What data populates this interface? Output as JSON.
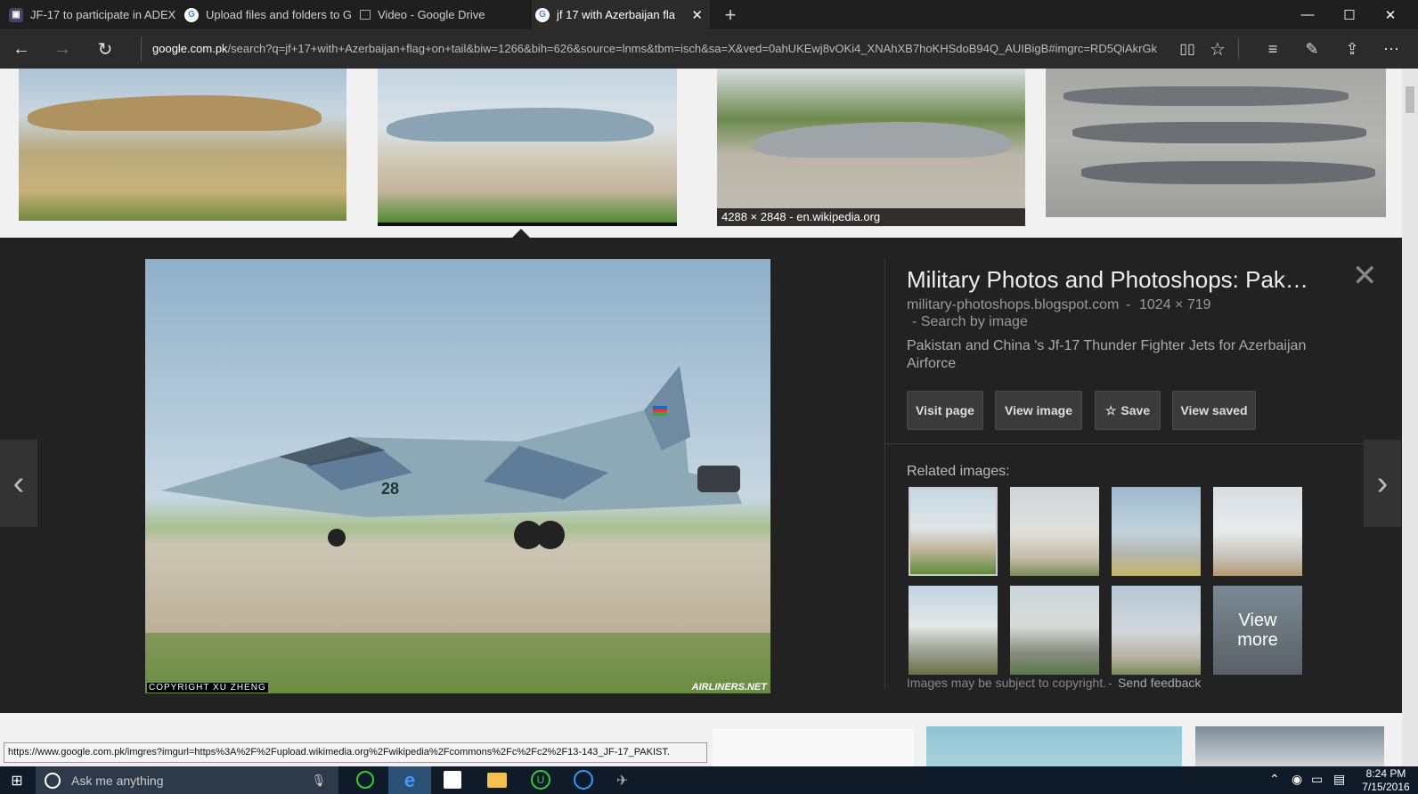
{
  "tabs": [
    {
      "label": "JF-17 to participate in ADEX",
      "icon": "site-favicon"
    },
    {
      "label": "Upload files and folders to G",
      "icon": "google-icon"
    },
    {
      "label": "Video - Google Drive",
      "icon": "page-icon"
    },
    {
      "label": "jf 17 with Azerbaijan fla",
      "icon": "google-icon"
    }
  ],
  "window": {
    "minimize": "—",
    "maximize": "☐",
    "close": "✕"
  },
  "nav": {
    "back": "←",
    "forward": "→",
    "refresh": "↻",
    "new_tab": "+",
    "close_tab": "✕"
  },
  "address": {
    "domain": "google.com.pk",
    "path": "/search?q=jf+17+with+Azerbaijan+flag+on+tail&biw=1266&bih=626&source=lnms&tbm=isch&sa=X&ved=0ahUKEwj8vOKi4_XNAhXB7hoKHSdoB94Q_AUIBigB#imgrc=RD5QiAkrGk"
  },
  "toolbar_icons": [
    "reading-view-icon",
    "favorite-star-icon",
    "hub-icon",
    "web-note-icon",
    "share-icon",
    "more-icon"
  ],
  "thumbnails": [
    {
      "caption": ""
    },
    {
      "caption": ""
    },
    {
      "caption": "4288 × 2848 - en.wikipedia.org"
    },
    {
      "caption": ""
    }
  ],
  "panel": {
    "title": "Military Photos and Photoshops: Pak…",
    "source": "military-photoshops.blogspot.com",
    "sep": "-",
    "dimensions": "1024 × 719",
    "search_by_image": "- Search by image",
    "description": "Pakistan and China 's Jf-17 Thunder Fighter Jets for Azerbaijan Airforce",
    "buttons": {
      "visit": "Visit page",
      "view_image": "View image",
      "save": "Save",
      "view_saved": "View saved"
    },
    "related_label": "Related images:",
    "view_more": "View more",
    "copyright": "Images may be subject to copyright.",
    "copy_sep": "-",
    "feedback": "Send feedback",
    "close": "✕",
    "prev": "‹",
    "next": "›",
    "img_credit_left": "COPYRIGHT XU ZHENG",
    "img_credit_right": "AIRLINERS.NET",
    "tail_number": "28"
  },
  "status_url": "https://www.google.com.pk/imgres?imgurl=https%3A%2F%2Fupload.wikimedia.org%2Fwikipedia%2Fcommons%2Fc%2Fc2%2F13-143_JF-17_PAKIST.",
  "taskbar": {
    "search_placeholder": "Ask me anything",
    "time": "8:24 PM",
    "date": "7/15/2016"
  }
}
